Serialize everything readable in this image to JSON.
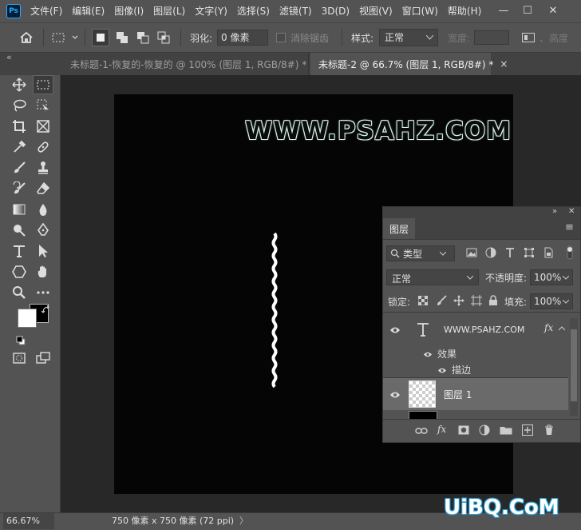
{
  "app": {
    "logo": "Ps"
  },
  "menu": [
    "文件(F)",
    "编辑(E)",
    "图像(I)",
    "图层(L)",
    "文字(Y)",
    "选择(S)",
    "滤镜(T)",
    "3D(D)",
    "视图(V)",
    "窗口(W)",
    "帮助(H)"
  ],
  "window_controls": {
    "minimize": "—",
    "maximize": "☐",
    "close": "✕"
  },
  "options": {
    "feather_label": "羽化:",
    "feather_value": "0 像素",
    "antialias_label": "消除锯齿",
    "style_label": "样式:",
    "style_value": "正常",
    "width_label": "宽度:",
    "height_label": "、高度"
  },
  "tabs": [
    {
      "title": "未标题-1-恢复的-恢复的 @ 100% (图层 1, RGB/8#) *",
      "close": "×",
      "active": false
    },
    {
      "title": "未标题-2 @ 66.7% (图层 1, RGB/8#) *",
      "close": "×",
      "active": true
    }
  ],
  "canvas": {
    "watermark": "WWW.PSAHZ.COM"
  },
  "layers_panel": {
    "title": "图层",
    "filter_value": "类型",
    "blend_mode": "正常",
    "opacity_label": "不透明度:",
    "opacity_value": "100%",
    "lock_label": "锁定:",
    "fill_label": "填充:",
    "fill_value": "100%",
    "layers": [
      {
        "name": "WWW.PSAHZ.COM",
        "kind": "text",
        "fx": "fx"
      },
      {
        "name": "效果",
        "kind": "effects"
      },
      {
        "name": "描边",
        "kind": "effect-item"
      },
      {
        "name": "图层 1",
        "kind": "pixel",
        "selected": true
      }
    ]
  },
  "status": {
    "zoom": "66.67%",
    "doc_info": "750 像素 x 750 像素 (72 ppi)",
    "arrow": "〉"
  },
  "corner_logo": "UiBQ.CoM",
  "colors": {
    "accent": "#31a8ff",
    "foreground": "#ffffff",
    "background": "#000000"
  }
}
